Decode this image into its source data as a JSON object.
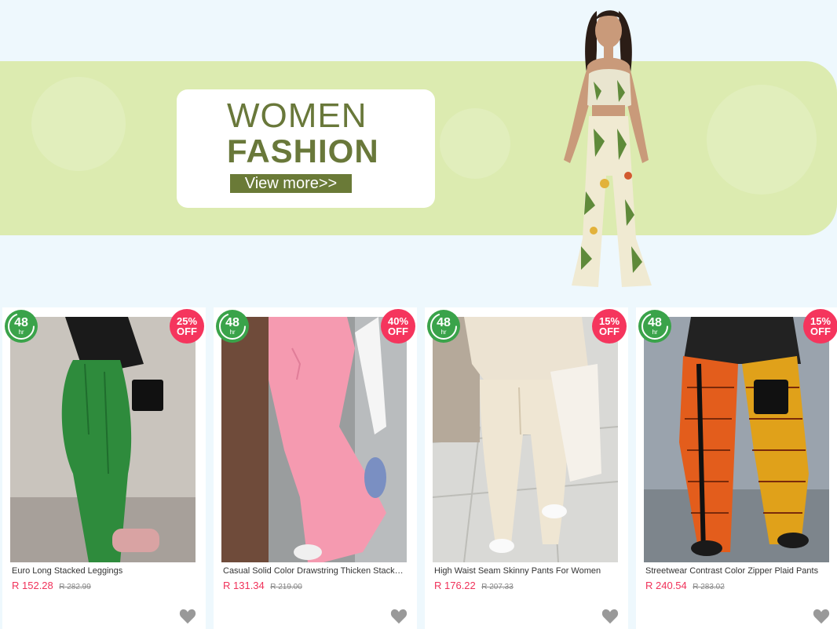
{
  "banner": {
    "line1": "WOMEN",
    "line2": "FASHION",
    "cta": "View more>>"
  },
  "colors": {
    "accent_green": "#6a7a37",
    "banner_bg": "#dcebb0",
    "sale_red": "#f5355d",
    "price_red": "#f0325a",
    "badge_green": "#3aa34a"
  },
  "badge_48": {
    "number": "48",
    "unit": "hr"
  },
  "products": [
    {
      "title": "Euro Long Stacked Leggings",
      "price": "R 152.28",
      "old_price": "R 282.99",
      "discount_pct": "25%",
      "discount_word": "OFF",
      "icon": "heart-icon"
    },
    {
      "title": "Casual Solid Color Drawstring Thicken Stacked Pants",
      "price": "R 131.34",
      "old_price": "R 219.00",
      "discount_pct": "40%",
      "discount_word": "OFF",
      "icon": "heart-icon"
    },
    {
      "title": "High Waist Seam Skinny Pants For Women",
      "price": "R 176.22",
      "old_price": "R 207.33",
      "discount_pct": "15%",
      "discount_word": "OFF",
      "icon": "heart-icon"
    },
    {
      "title": "Streetwear Contrast Color Zipper Plaid Pants",
      "price": "R 240.54",
      "old_price": "R 283.02",
      "discount_pct": "15%",
      "discount_word": "OFF",
      "icon": "heart-icon"
    }
  ]
}
